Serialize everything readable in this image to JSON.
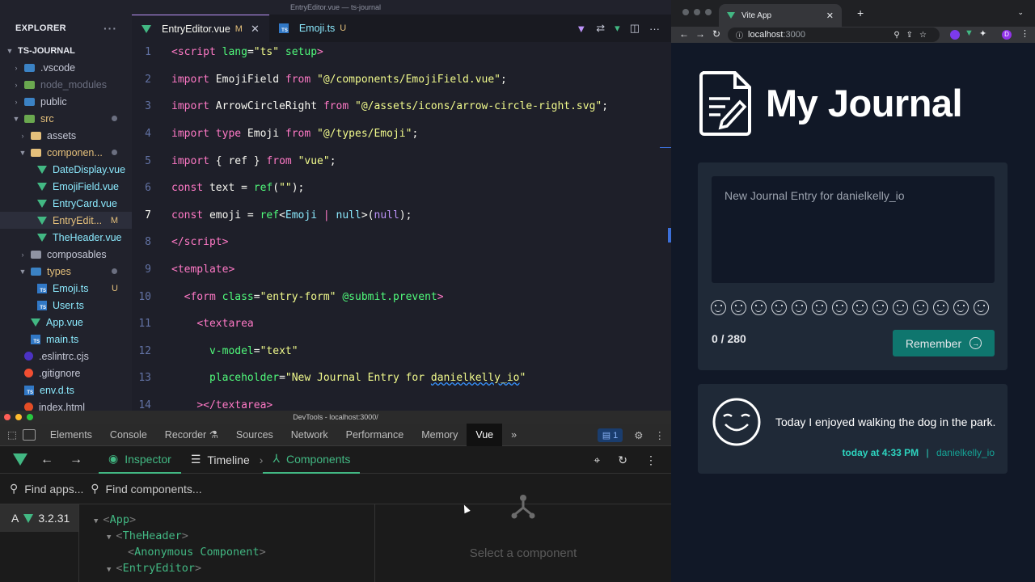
{
  "vscode": {
    "window_title": "EntryEditor.vue — ts-journal",
    "explorer_label": "EXPLORER",
    "project": "TS-JOURNAL",
    "tree": [
      {
        "label": ".vscode",
        "type": "folder",
        "color": "#3b82c4",
        "indent": 1
      },
      {
        "label": "node_modules",
        "type": "folder",
        "color": "#6aa84f",
        "indent": 1,
        "dim": true
      },
      {
        "label": "public",
        "type": "folder",
        "color": "#3b82c4",
        "indent": 1
      },
      {
        "label": "src",
        "type": "folder",
        "color": "#6aa84f",
        "indent": 1,
        "open": true,
        "dot": true
      },
      {
        "label": "assets",
        "type": "folder",
        "color": "#e5c07b",
        "indent": 2
      },
      {
        "label": "componen...",
        "type": "folder",
        "color": "#e5c07b",
        "indent": 2,
        "open": true,
        "dot": true
      },
      {
        "label": "DateDisplay.vue",
        "type": "vue",
        "indent": 3
      },
      {
        "label": "EmojiField.vue",
        "type": "vue",
        "indent": 3
      },
      {
        "label": "EntryCard.vue",
        "type": "vue",
        "indent": 3
      },
      {
        "label": "EntryEdit...",
        "type": "vue",
        "indent": 3,
        "badge": "M",
        "selected": true
      },
      {
        "label": "TheHeader.vue",
        "type": "vue",
        "indent": 3
      },
      {
        "label": "composables",
        "type": "folder",
        "color": "#8f93a2",
        "indent": 2
      },
      {
        "label": "types",
        "type": "folder",
        "color": "#3b82c4",
        "indent": 2,
        "open": true,
        "dot": true
      },
      {
        "label": "Emoji.ts",
        "type": "ts",
        "indent": 3,
        "badge": "U"
      },
      {
        "label": "User.ts",
        "type": "ts",
        "indent": 3
      },
      {
        "label": "App.vue",
        "type": "vue",
        "indent": 2
      },
      {
        "label": "main.ts",
        "type": "ts",
        "indent": 2
      },
      {
        "label": ".eslintrc.cjs",
        "type": "other",
        "color": "#4b32c3",
        "indent": 1
      },
      {
        "label": ".gitignore",
        "type": "other",
        "color": "#f14e32",
        "indent": 1
      },
      {
        "label": "env.d.ts",
        "type": "ts",
        "indent": 1
      },
      {
        "label": "index.html",
        "type": "other",
        "color": "#e44d26",
        "indent": 1
      }
    ],
    "tabs": [
      {
        "label": "EntryEditor.vue",
        "status": "M",
        "active": true
      },
      {
        "label": "Emoji.ts",
        "status": "U",
        "active": false
      }
    ],
    "line_numbers": [
      "1",
      "2",
      "3",
      "4",
      "5",
      "6",
      "7",
      "8",
      "9",
      "10",
      "11",
      "12",
      "13",
      "14"
    ],
    "current_line": "7"
  },
  "devtools": {
    "title": "DevTools - localhost:3000/",
    "tabs": [
      "Elements",
      "Console",
      "Recorder",
      "Sources",
      "Network",
      "Performance",
      "Memory",
      "Vue"
    ],
    "message_count": "1",
    "vue_tabs": [
      "Inspector",
      "Timeline",
      "Components"
    ],
    "find_apps_placeholder": "Find apps...",
    "find_components_placeholder": "Find components...",
    "app_letter": "A",
    "vue_version": "3.2.31",
    "component_tree": [
      {
        "name": "App",
        "depth": 0
      },
      {
        "name": "TheHeader",
        "depth": 1
      },
      {
        "name": "Anonymous Component",
        "depth": 2
      },
      {
        "name": "EntryEditor",
        "depth": 1
      }
    ],
    "empty_state": "Select a component"
  },
  "browser": {
    "tab_title": "Vite App",
    "url_host": "localhost",
    "url_port": ":3000",
    "profile_initial": "D",
    "page": {
      "heading": "My Journal",
      "textarea_placeholder": "New Journal Entry for danielkelly_io",
      "emoji_count": 14,
      "counter": "0 / 280",
      "button": "Remember",
      "entry_text": "Today I enjoyed walking the dog in the park.",
      "entry_date": "today at 4:33 PM",
      "entry_separator": "|",
      "entry_user": "danielkelly_io"
    }
  }
}
